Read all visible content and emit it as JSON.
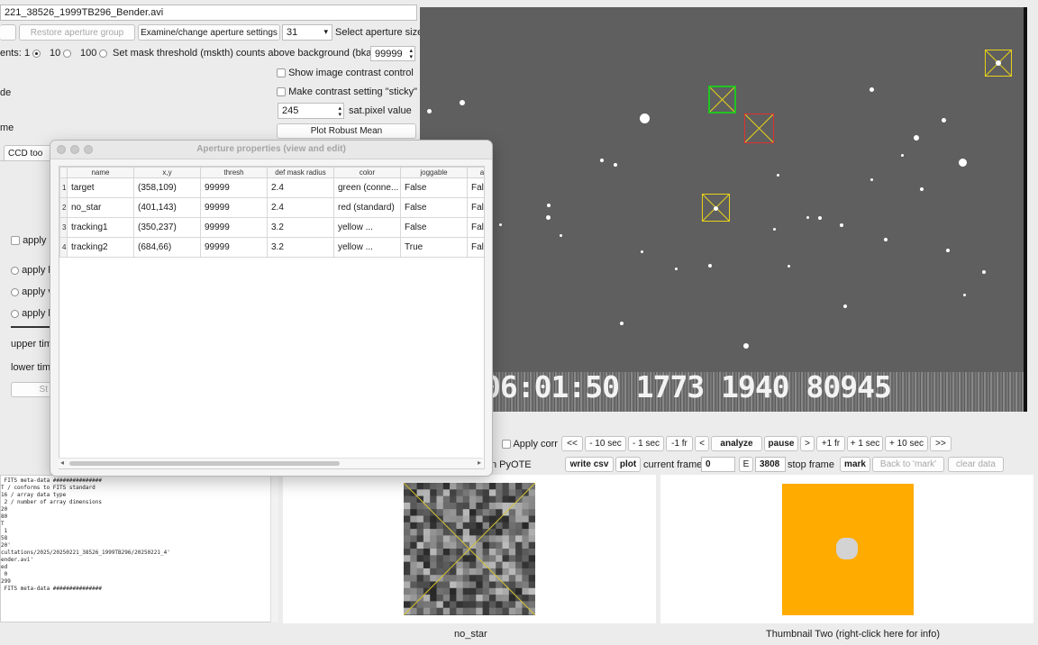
{
  "file_name": "221_38526_1999TB296_Bender.avi",
  "toolbar": {
    "restore_group_label": "Restore aperture group",
    "examine_settings_label": "Examine/change aperture settings",
    "aperture_size_value": "31",
    "aperture_size_label": "Select aperture size"
  },
  "mask": {
    "increments_label": "ents:",
    "opt1": "1",
    "opt10": "10",
    "opt100": "100",
    "threshold_label": "Set mask threshold (mskth) counts above background (bkavg)",
    "threshold_value": "99999"
  },
  "left_labels": {
    "de": "de",
    "me": "me",
    "ccd_tab": "CCD too",
    "apply_partial1": "apply '",
    "apply_partial2": "apply l",
    "apply_partial3": "apply v",
    "apply_partial4": "apply l",
    "upper_time": "upper tim",
    "lower_time": "lower time",
    "st_btn": "St"
  },
  "contrast": {
    "show_contrast_label": "Show image contrast control",
    "sticky_label": "Make contrast setting \"sticky\"",
    "sat_value": "245",
    "sat_label": "sat.pixel value",
    "robust_mean_label": "Plot Robust Mean"
  },
  "modal": {
    "title": "Aperture properties (view and edit)",
    "columns": [
      "name",
      "x,y",
      "thresh",
      "def mask radius",
      "color",
      "joggable",
      "a"
    ],
    "rows": [
      {
        "num": "1",
        "name": "target",
        "xy": "(358,109)",
        "thresh": "99999",
        "radius": "2.4",
        "color": "green (conne...",
        "joggable": "False",
        "extra": "Fals"
      },
      {
        "num": "2",
        "name": "no_star",
        "xy": "(401,143)",
        "thresh": "99999",
        "radius": "2.4",
        "color": "red (standard)",
        "joggable": "False",
        "extra": "Fals"
      },
      {
        "num": "3",
        "name": "tracking1",
        "xy": "(350,237)",
        "thresh": "99999",
        "radius": "3.2",
        "color": "yellow ...",
        "joggable": "False",
        "extra": "Fals"
      },
      {
        "num": "4",
        "name": "tracking2",
        "xy": "(684,66)",
        "thresh": "99999",
        "radius": "3.2",
        "color": "yellow ...",
        "joggable": "True",
        "extra": "Fals"
      }
    ]
  },
  "video": {
    "timestamp_overlay": "06:01:50 1773 1940 80945"
  },
  "controls": {
    "apply_corr_label": "Apply corr",
    "nav": [
      "<<",
      "- 10 sec",
      "- 1 sec",
      "-1 fr",
      "<",
      "analyze",
      "pause",
      ">",
      "+1 fr",
      "+ 1 sec",
      "+ 10 sec",
      ">>"
    ],
    "run_pyote_label": "n PyOTE",
    "write_csv_label": "write csv",
    "plot_label": "plot",
    "current_frame_label": "current frame:",
    "current_frame_value": "0",
    "e_label": "E",
    "stop_frame_value": "3808",
    "stop_frame_label": "stop frame",
    "mark_label": "mark",
    "back_to_mark_label": "Back to 'mark'",
    "clear_data_label": "clear data"
  },
  "log_lines": [
    " FITS meta-data ###############",
    "",
    "T / conforms to FITS standard",
    "16 / array data type",
    " 2 / number of array dimensions",
    "20",
    "80",
    "T",
    " 1",
    "58",
    "20'",
    "",
    "cultations/2025/20250221_38526_1999TB296/20250221_4'",
    "ender.avi'",
    "ed",
    " 0",
    "299",
    "",
    " FITS meta-data ###############"
  ],
  "thumbnails": {
    "one_caption": "no_star",
    "two_caption": "Thumbnail Two (right-click here for info)"
  },
  "colors": {
    "green_aperture": "#22c322",
    "red_aperture": "#e03030",
    "yellow_aperture": "#e8d21a",
    "thumbnail_two_bg": "#ffab00"
  }
}
